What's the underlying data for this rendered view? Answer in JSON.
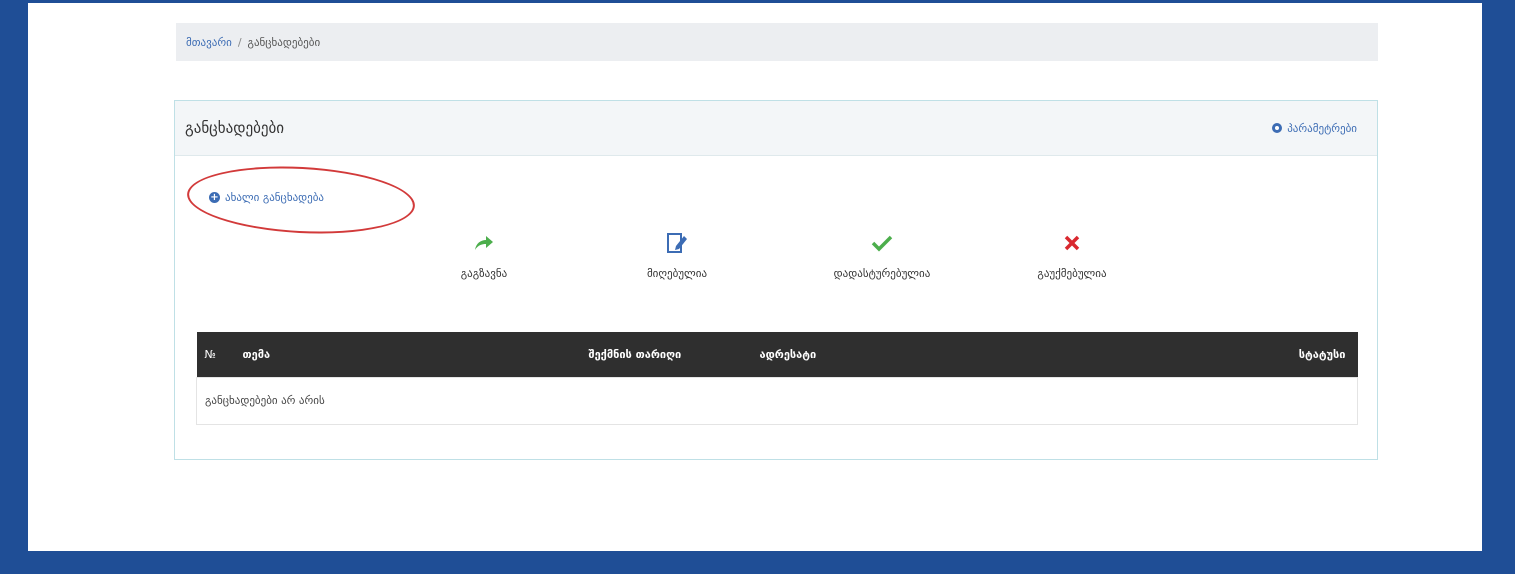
{
  "breadcrumb": {
    "home": "მთავარი",
    "separator": "/",
    "current": "განცხადებები"
  },
  "panel": {
    "title": "განცხადებები",
    "params_label": "პარამეტრები",
    "new_label": "ახალი განცხადება"
  },
  "statuses": [
    {
      "label": "გაგზავნა",
      "icon": "share-arrow-icon",
      "color": "#4cae4c"
    },
    {
      "label": "მიღებულია",
      "icon": "edit-document-icon",
      "color": "#3c6cb4"
    },
    {
      "label": "დადასტურებულია",
      "icon": "check-icon",
      "color": "#4cae4c"
    },
    {
      "label": "გაუქმებულია",
      "icon": "close-icon",
      "color": "#d9282f"
    }
  ],
  "table": {
    "headers": {
      "num": "№",
      "subject": "თემა",
      "date": "შექმნის თარიღი",
      "recipient": "ადრესატი",
      "status": "სტატუსი"
    },
    "empty": "განცხადებები არ არის"
  },
  "colors": {
    "outer": "#1f4e96",
    "accent": "#3c6cb4",
    "header_bg": "#2f2f2f"
  }
}
